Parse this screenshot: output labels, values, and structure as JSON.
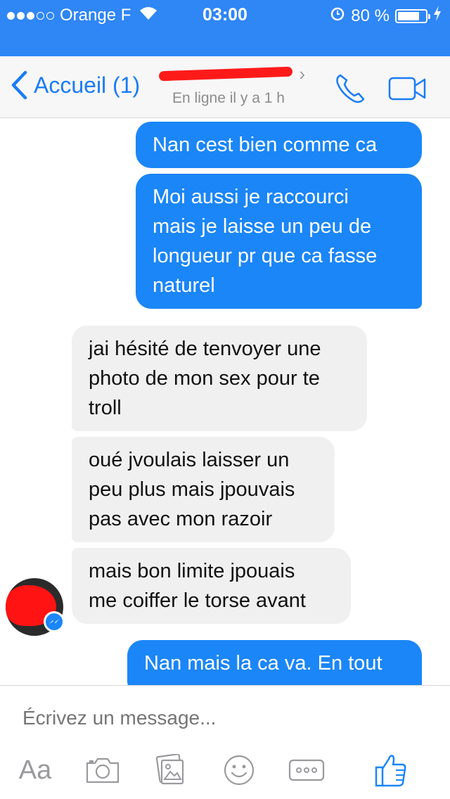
{
  "status_bar": {
    "carrier": "Orange F",
    "time": "03:00",
    "battery": "80 %",
    "battery_level": 0.8
  },
  "header": {
    "back_label": "Accueil (1)",
    "contact_status": "En ligne il y a 1 h"
  },
  "messages": [
    {
      "direction": "out",
      "text": [
        "Nan cest bien comme ca"
      ]
    },
    {
      "direction": "out",
      "text": [
        "Moi aussi je raccourci",
        "mais je laisse un peu de",
        "longueur pr que ca fasse",
        "naturel"
      ]
    },
    {
      "direction": "in",
      "text": [
        "jai hésité de tenvoyer une",
        "photo de mon sex pour te",
        "troll"
      ]
    },
    {
      "direction": "in",
      "text": [
        "oué jvoulais laisser un",
        "peu plus mais jpouvais",
        "pas avec mon razoir"
      ]
    },
    {
      "direction": "in",
      "text": [
        "mais bon limite jpouais",
        "me coiffer le torse avant"
      ]
    },
    {
      "direction": "out",
      "text": [
        "Nan mais la ca va. En tout"
      ]
    }
  ],
  "composer": {
    "placeholder": "Écrivez un message...",
    "aa_label": "Aa"
  },
  "colors": {
    "accent": "#1b86f7",
    "status_bar": "#2f86f5",
    "incoming_bubble": "#f0f0f0",
    "redaction": "#ff1a1a"
  },
  "icons": [
    "back-chevron-icon",
    "phone-icon",
    "video-camera-icon",
    "camera-icon",
    "photo-gallery-icon",
    "emoji-icon",
    "more-icon",
    "thumbs-up-icon",
    "messenger-badge-icon"
  ]
}
